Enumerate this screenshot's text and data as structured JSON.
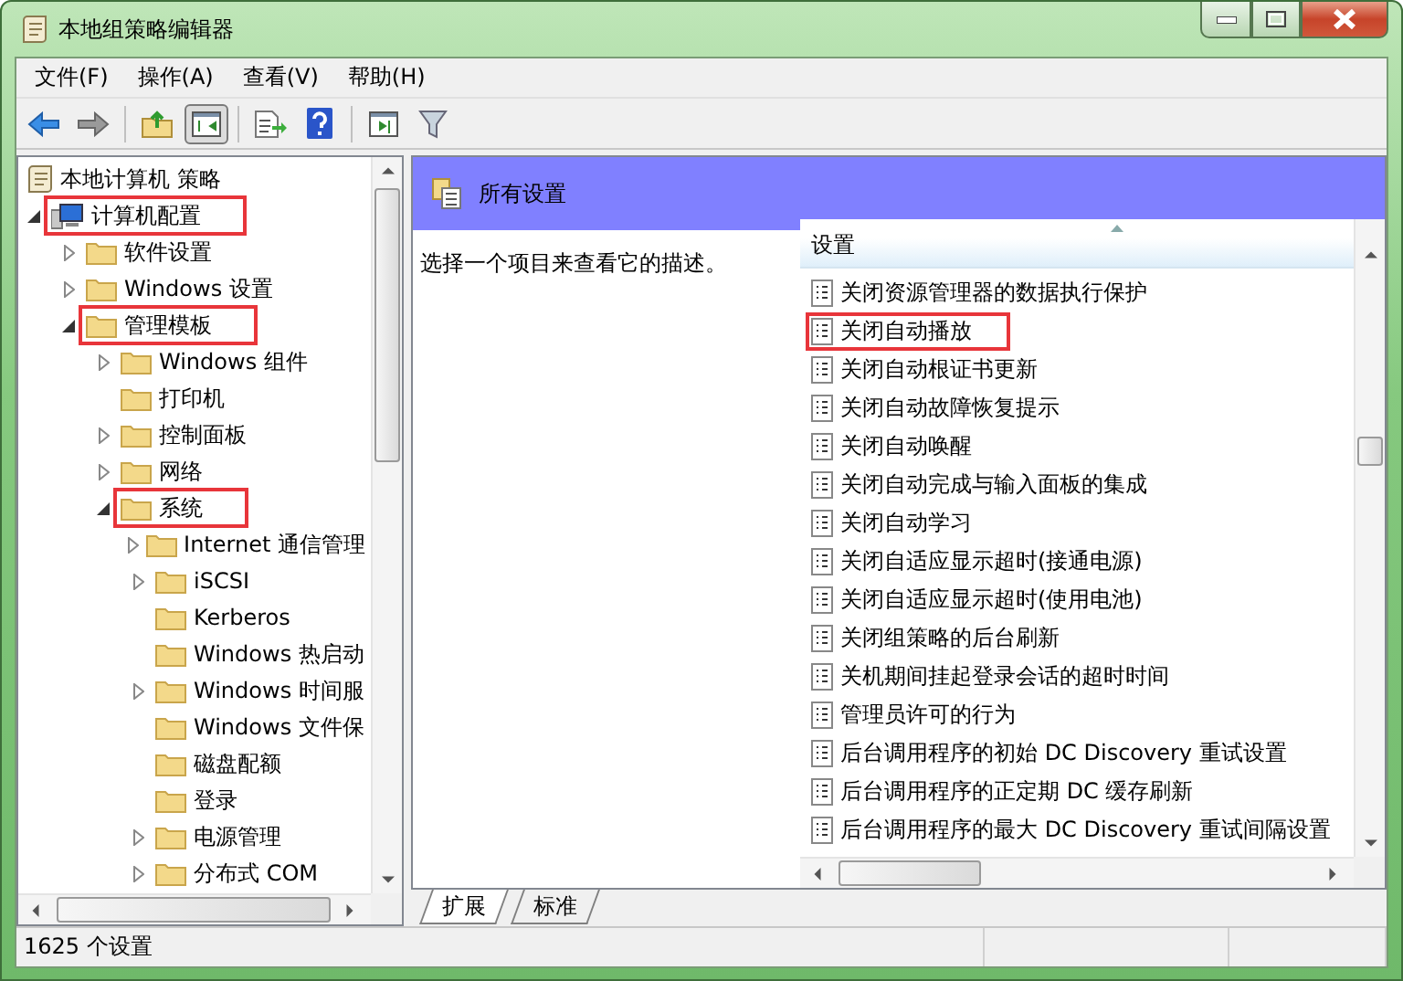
{
  "window": {
    "title": "本地组策略编辑器"
  },
  "menu": [
    "文件(F)",
    "操作(A)",
    "查看(V)",
    "帮助(H)"
  ],
  "toolbar": [
    {
      "kind": "back",
      "pressed": false
    },
    {
      "kind": "forward",
      "pressed": false
    },
    {
      "kind": "up",
      "pressed": false
    },
    {
      "kind": "tree",
      "pressed": true
    },
    {
      "kind": "export",
      "pressed": false
    },
    {
      "kind": "help",
      "pressed": false
    },
    {
      "kind": "panel",
      "pressed": false
    },
    {
      "kind": "filter",
      "pressed": false
    }
  ],
  "tree": {
    "root": "本地计算机 策略",
    "items": [
      {
        "label": "计算机配置",
        "kind": "computer",
        "expanded": true,
        "highlighted": true,
        "children": [
          {
            "label": "软件设置",
            "kind": "folder",
            "expanded": false,
            "highlighted": false
          },
          {
            "label": "Windows 设置",
            "kind": "folder",
            "expanded": false,
            "highlighted": false
          },
          {
            "label": "管理模板",
            "kind": "folder",
            "expanded": true,
            "highlighted": true,
            "children": [
              {
                "label": "Windows 组件",
                "kind": "folder",
                "expanded": false,
                "highlighted": false
              },
              {
                "label": "打印机",
                "kind": "folder",
                "highlighted": false
              },
              {
                "label": "控制面板",
                "kind": "folder",
                "expanded": false,
                "highlighted": false
              },
              {
                "label": "网络",
                "kind": "folder",
                "expanded": false,
                "highlighted": false
              },
              {
                "label": "系统",
                "kind": "folder",
                "expanded": true,
                "highlighted": true,
                "children": [
                  {
                    "label": "Internet 通信管理",
                    "kind": "folder",
                    "expanded": false,
                    "highlighted": false
                  },
                  {
                    "label": "iSCSI",
                    "kind": "folder",
                    "expanded": false,
                    "highlighted": false
                  },
                  {
                    "label": "Kerberos",
                    "kind": "folder",
                    "highlighted": false
                  },
                  {
                    "label": "Windows 热启动",
                    "kind": "folder",
                    "highlighted": false
                  },
                  {
                    "label": "Windows 时间服",
                    "kind": "folder",
                    "expanded": false,
                    "highlighted": false
                  },
                  {
                    "label": "Windows 文件保",
                    "kind": "folder",
                    "highlighted": false
                  },
                  {
                    "label": "磁盘配额",
                    "kind": "folder",
                    "highlighted": false
                  },
                  {
                    "label": "登录",
                    "kind": "folder",
                    "highlighted": false
                  },
                  {
                    "label": "电源管理",
                    "kind": "folder",
                    "expanded": false,
                    "highlighted": false
                  },
                  {
                    "label": "分布式 COM",
                    "kind": "folder",
                    "expanded": false,
                    "highlighted": false
                  }
                ]
              }
            ]
          }
        ]
      }
    ]
  },
  "details": {
    "title": "所有设置",
    "description": "选择一个项目来查看它的描述。",
    "column": "设置",
    "settings": [
      {
        "label": "关闭资源管理器的数据执行保护",
        "highlighted": false
      },
      {
        "label": "关闭自动播放",
        "highlighted": true
      },
      {
        "label": "关闭自动根证书更新",
        "highlighted": false
      },
      {
        "label": "关闭自动故障恢复提示",
        "highlighted": false
      },
      {
        "label": "关闭自动唤醒",
        "highlighted": false
      },
      {
        "label": "关闭自动完成与输入面板的集成",
        "highlighted": false
      },
      {
        "label": "关闭自动学习",
        "highlighted": false
      },
      {
        "label": "关闭自适应显示超时(接通电源)",
        "highlighted": false
      },
      {
        "label": "关闭自适应显示超时(使用电池)",
        "highlighted": false
      },
      {
        "label": "关闭组策略的后台刷新",
        "highlighted": false
      },
      {
        "label": "关机期间挂起登录会话的超时时间",
        "highlighted": false
      },
      {
        "label": "管理员许可的行为",
        "highlighted": false
      },
      {
        "label": "后台调用程序的初始 DC Discovery 重试设置",
        "highlighted": false
      },
      {
        "label": "后台调用程序的正定期 DC 缓存刷新",
        "highlighted": false
      },
      {
        "label": "后台调用程序的最大 DC Discovery 重试间隔设置",
        "highlighted": false
      }
    ]
  },
  "tabs": [
    {
      "label": "扩展",
      "selected": true
    },
    {
      "label": "标准",
      "selected": false
    }
  ],
  "status_bar": "1625 个设置"
}
